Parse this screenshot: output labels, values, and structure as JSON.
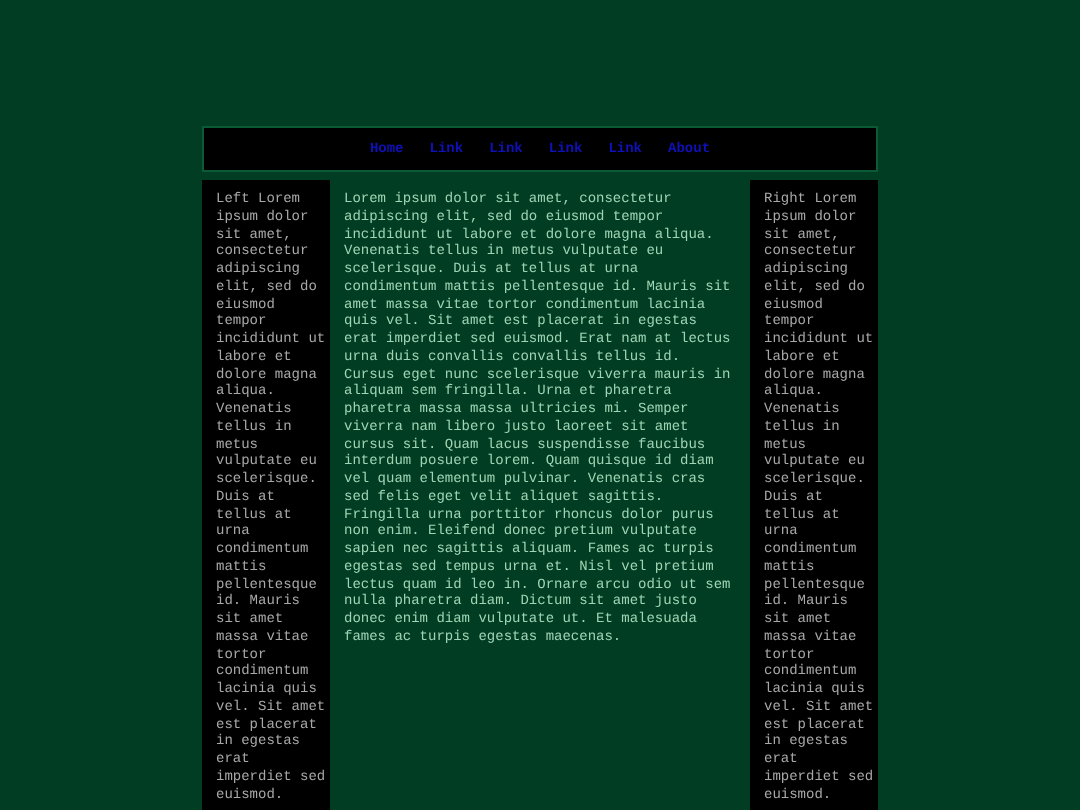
{
  "nav": {
    "links": [
      "Home",
      "Link",
      "Link",
      "Link",
      "Link",
      "About"
    ]
  },
  "left_sidebar": {
    "text": "Left Lorem ipsum dolor sit amet, consectetur adipiscing elit, sed do eiusmod tempor incididunt ut labore et dolore magna aliqua. Venenatis tellus in metus vulputate eu scelerisque. Duis at tellus at urna condimentum mattis pellentesque id. Mauris sit amet massa vitae tortor condimentum lacinia quis vel. Sit amet est placerat in egestas erat imperdiet sed euismod."
  },
  "main": {
    "text": "Lorem ipsum dolor sit amet, consectetur adipiscing elit, sed do eiusmod tempor incididunt ut labore et dolore magna aliqua. Venenatis tellus in metus vulputate eu scelerisque. Duis at tellus at urna condimentum mattis pellentesque id. Mauris sit amet massa vitae tortor condimentum lacinia quis vel. Sit amet est placerat in egestas erat imperdiet sed euismod. Erat nam at lectus urna duis convallis convallis tellus id. Cursus eget nunc scelerisque viverra mauris in aliquam sem fringilla. Urna et pharetra pharetra massa massa ultricies mi. Semper viverra nam libero justo laoreet sit amet cursus sit. Quam lacus suspendisse faucibus interdum posuere lorem. Quam quisque id diam vel quam elementum pulvinar. Venenatis cras sed felis eget velit aliquet sagittis. Fringilla urna porttitor rhoncus dolor purus non enim. Eleifend donec pretium vulputate sapien nec sagittis aliquam. Fames ac turpis egestas sed tempus urna et. Nisl vel pretium lectus quam id leo in. Ornare arcu odio ut sem nulla pharetra diam. Dictum sit amet justo donec enim diam vulputate ut. Et malesuada fames ac turpis egestas maecenas."
  },
  "right_sidebar": {
    "text": "Right Lorem ipsum dolor sit amet, consectetur adipiscing elit, sed do eiusmod tempor incididunt ut labore et dolore magna aliqua. Venenatis tellus in metus vulputate eu scelerisque. Duis at tellus at urna condimentum mattis pellentesque id. Mauris sit amet massa vitae tortor condimentum lacinia quis vel. Sit amet est placerat in egestas erat imperdiet sed euismod."
  }
}
